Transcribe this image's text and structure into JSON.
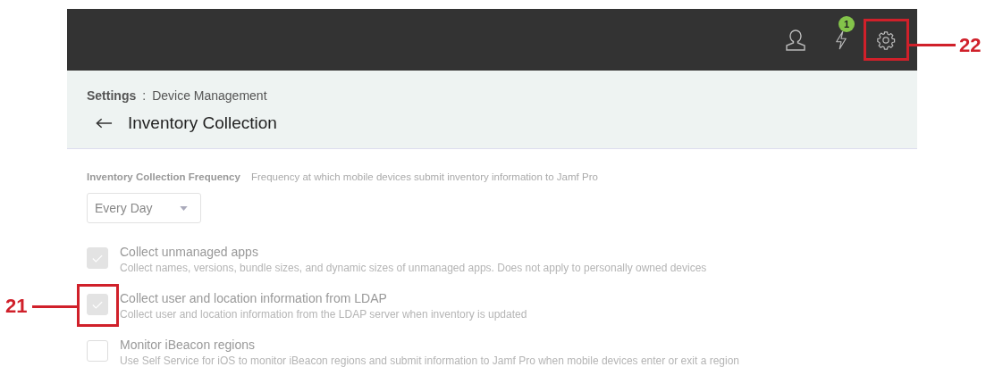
{
  "topbar": {
    "notification_count": "1"
  },
  "breadcrumb": {
    "section": "Settings",
    "separator": ":",
    "page": "Device Management"
  },
  "title": "Inventory Collection",
  "frequency": {
    "label": "Inventory Collection Frequency",
    "description": "Frequency at which mobile devices submit inventory information to Jamf Pro",
    "value": "Every Day"
  },
  "options": [
    {
      "label": "Collect unmanaged apps",
      "description": "Collect names, versions, bundle sizes, and dynamic sizes of unmanaged apps. Does not apply to personally owned devices",
      "checked": true
    },
    {
      "label": "Collect user and location information from LDAP",
      "description": "Collect user and location information from the LDAP server when inventory is updated",
      "checked": true
    },
    {
      "label": "Monitor iBeacon regions",
      "description": "Use Self Service for iOS to monitor iBeacon regions and submit information to Jamf Pro when mobile devices enter or exit a region",
      "checked": false
    }
  ],
  "callouts": [
    {
      "number": "21",
      "kind": "left"
    },
    {
      "number": "22",
      "kind": "right"
    }
  ]
}
